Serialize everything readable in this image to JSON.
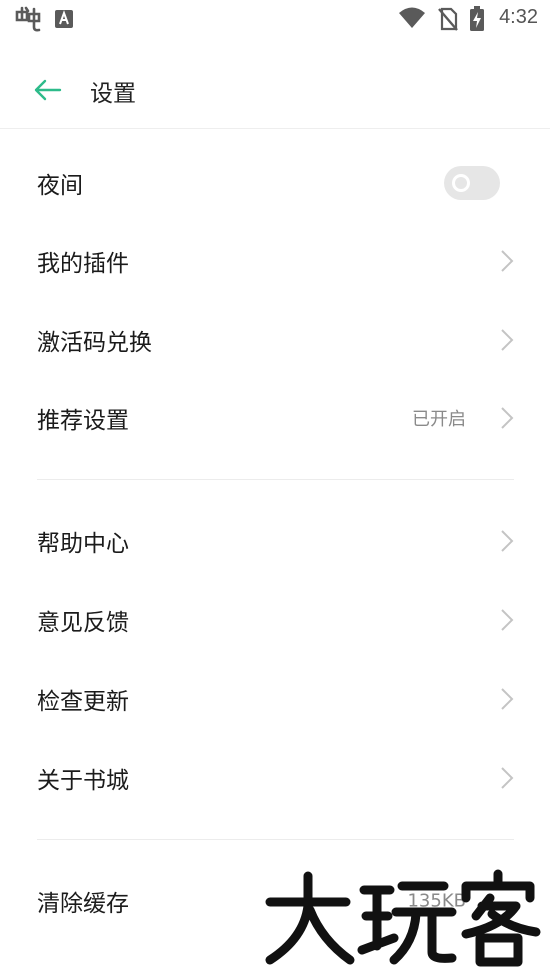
{
  "status_bar": {
    "time": "4:32",
    "left_icons": [
      "app-notification-icon",
      "font-a-icon"
    ],
    "right_icons": [
      "wifi-icon",
      "no-sim-icon",
      "battery-charging-icon"
    ]
  },
  "header": {
    "title": "设置",
    "back_icon": "arrow-left-icon",
    "accent_color": "#2dbb8a"
  },
  "group1": [
    {
      "label": "夜间",
      "control": "toggle",
      "toggle_on": false
    },
    {
      "label": "我的插件",
      "control": "chevron"
    },
    {
      "label": "激活码兑换",
      "control": "chevron"
    },
    {
      "label": "推荐设置",
      "value": "已开启",
      "control": "chevron"
    }
  ],
  "group2": [
    {
      "label": "帮助中心",
      "control": "chevron"
    },
    {
      "label": "意见反馈",
      "control": "chevron"
    },
    {
      "label": "检查更新",
      "control": "chevron"
    },
    {
      "label": "关于书城",
      "control": "chevron"
    }
  ],
  "group3": [
    {
      "label": "清除缓存",
      "value": "135KB",
      "control": "none"
    }
  ],
  "watermark": {
    "text": "大玩客"
  }
}
